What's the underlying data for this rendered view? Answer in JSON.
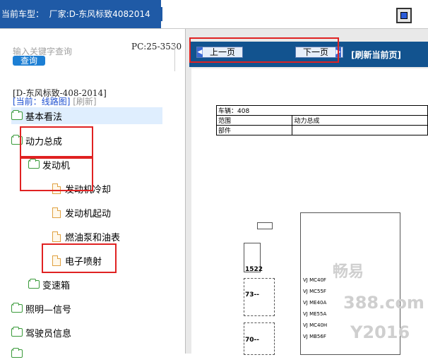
{
  "header": {
    "label": "当前车型：",
    "vendor_prefix": "厂家:",
    "model": "D-东风标致4082014"
  },
  "search": {
    "placeholder": "输入关键字查询",
    "button": "查询",
    "pc": "PC:25-3530"
  },
  "model_line": "[D-东风标致-408-2014]",
  "current": {
    "prefix": "[当前：",
    "link": "线路图",
    "suffix": "]",
    "refresh": "[刷新]"
  },
  "tree": [
    {
      "label": "基本看法",
      "icon": "folder-icon",
      "highlighted": true
    },
    {
      "label": "动力总成",
      "icon": "folder-icon"
    },
    {
      "label": "发动机",
      "icon": "folder-icon"
    },
    {
      "label": "发动机冷却",
      "icon": "file-icon"
    },
    {
      "label": "发动机起动",
      "icon": "file-icon"
    },
    {
      "label": "燃油泵和油表",
      "icon": "file-icon"
    },
    {
      "label": "电子喷射",
      "icon": "file-icon"
    },
    {
      "label": "变速箱",
      "icon": "folder-icon"
    },
    {
      "label": "照明—信号",
      "icon": "folder-icon"
    },
    {
      "label": "驾驶员信息",
      "icon": "folder-icon"
    },
    {
      "label": "",
      "icon": "folder-icon"
    }
  ],
  "nav": {
    "prev": "上一页",
    "next": "下一页",
    "refresh": "[刷新当前页]"
  },
  "document": {
    "car_label": "车辆：408",
    "range_label": "范围",
    "powertrain": "动力总成",
    "part_label": "部件",
    "plug_1522": "1522",
    "code_73": "73--",
    "code_70": "70--",
    "vj_labels": [
      "VJ MC40F",
      "VJ MC55F",
      "VJ ME40A",
      "VJ ME55A",
      "VJ MC40H",
      "VJ MB56F"
    ]
  },
  "watermark": [
    "畅易",
    "388.com",
    "Y2016"
  ],
  "colors": {
    "accent": "#12538f",
    "highlight_box": "#e02222",
    "tree_highlight": "#dfeefe",
    "link": "#1d4fd0"
  }
}
